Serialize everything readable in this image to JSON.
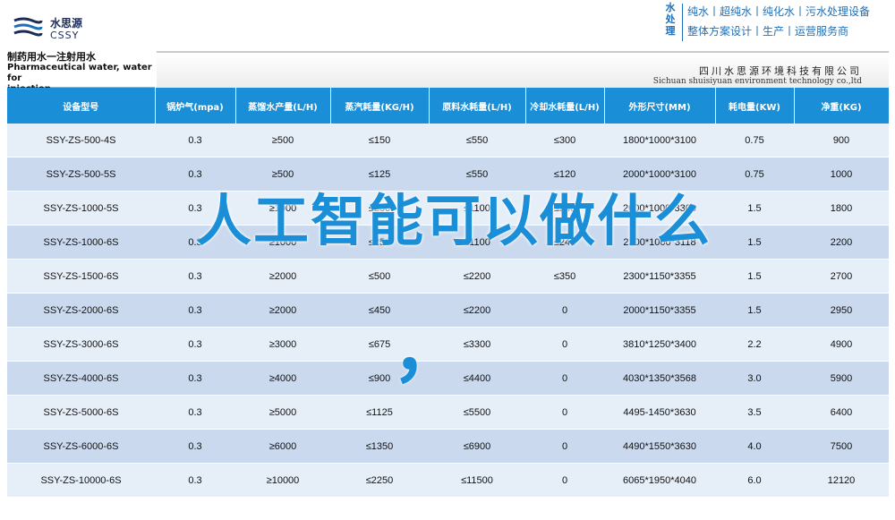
{
  "brand": {
    "name_cn": "水思源",
    "name_en": "CSSY"
  },
  "header": {
    "vertical_label": [
      "水",
      "处",
      "理"
    ],
    "services_line1": "纯水丨超纯水丨纯化水丨污水处理设备",
    "services_line2": "整体方案设计丨生产丨运营服务商"
  },
  "product": {
    "title_cn": "制药用水一注射用水",
    "title_en_1": "Pharmaceutical water, water for",
    "title_en_2": "injection"
  },
  "company": {
    "name_cn": "四川水思源环境科技有限公司",
    "name_en": "Sichuan shuisiyuan environment technology co.,ltd"
  },
  "table": {
    "headers": [
      "设备型号",
      "锅炉气(mpa)",
      "蒸馏水产量(L/H)",
      "蒸汽耗量(KG/H)",
      "原料水耗量(L/H)",
      "冷却水耗量(L/H)",
      "外形尺寸(MM)",
      "耗电量(KW)",
      "净重(KG)"
    ],
    "rows": [
      [
        "SSY-ZS-500-4S",
        "0.3",
        "≥500",
        "≤150",
        "≤550",
        "≤300",
        "1800*1000*3100",
        "0.75",
        "900"
      ],
      [
        "SSY-ZS-500-5S",
        "0.3",
        "≥500",
        "≤125",
        "≤550",
        "≤120",
        "2000*1000*3100",
        "0.75",
        "1000"
      ],
      [
        "SSY-ZS-1000-5S",
        "0.3",
        "≥1000",
        "≤250",
        "≤1100",
        "≤240",
        "2000*1000*3300",
        "1.5",
        "1800"
      ],
      [
        "SSY-ZS-1000-6S",
        "0.3",
        "≥1000",
        "≤250",
        "≤1100",
        "≤240",
        "2300*1000*3118",
        "1.5",
        "2200"
      ],
      [
        "SSY-ZS-1500-6S",
        "0.3",
        "≥2000",
        "≤500",
        "≤2200",
        "≤350",
        "2300*1150*3355",
        "1.5",
        "2700"
      ],
      [
        "SSY-ZS-2000-6S",
        "0.3",
        "≥2000",
        "≤450",
        "≤2200",
        "0",
        "2000*1150*3355",
        "1.5",
        "2950"
      ],
      [
        "SSY-ZS-3000-6S",
        "0.3",
        "≥3000",
        "≤675",
        "≤3300",
        "0",
        "3810*1250*3400",
        "2.2",
        "4900"
      ],
      [
        "SSY-ZS-4000-6S",
        "0.3",
        "≥4000",
        "≤900",
        "≤4400",
        "0",
        "4030*1350*3568",
        "3.0",
        "5900"
      ],
      [
        "SSY-ZS-5000-6S",
        "0.3",
        "≥5000",
        "≤1125",
        "≤5500",
        "0",
        "4495-1450*3630",
        "3.5",
        "6400"
      ],
      [
        "SSY-ZS-6000-6S",
        "0.3",
        "≥6000",
        "≤1350",
        "≤6900",
        "0",
        "4490*1550*3630",
        "4.0",
        "7500"
      ],
      [
        "SSY-ZS-10000-6S",
        "0.3",
        "≥10000",
        "≤2250",
        "≤11500",
        "0",
        "6065*1950*4040",
        "6.0",
        "12120"
      ]
    ]
  },
  "overlay": {
    "text": "人工智能可以做什么",
    "comma": "，"
  },
  "colors": {
    "header_blue": "#1a8fd8",
    "row_light": "#e6eef8",
    "row_dark": "#cad9ed",
    "brand_navy": "#1c2b57"
  }
}
